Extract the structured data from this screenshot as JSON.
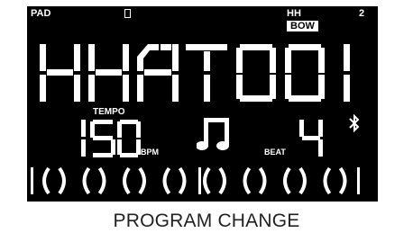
{
  "lcd": {
    "pad_label": "PAD",
    "memory_card_icon": "card-slot-icon",
    "pad_type_label": "HH",
    "articulation_badge": "BOW",
    "pad_number": "2",
    "instrument_name": "HHAT",
    "program_number": "001",
    "tempo_label": "TEMPO",
    "tempo_value": "150",
    "tempo_unit": "BPM",
    "note_icon": "eighth-notes-icon",
    "beat_label": "BEAT",
    "beat_value": "4",
    "bluetooth_icon": "bluetooth-icon",
    "beat_indicators": 8,
    "colors": {
      "background": "#000000",
      "foreground": "#ffffff"
    }
  },
  "caption": "PROGRAM CHANGE"
}
